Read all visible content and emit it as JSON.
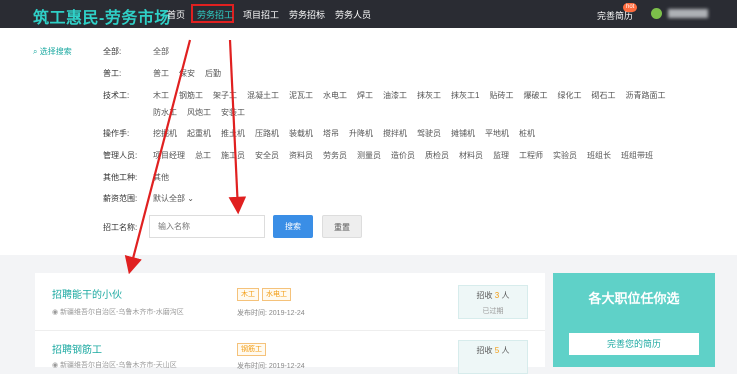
{
  "header": {
    "logo": "筑工惠民-劳务市场",
    "nav": [
      "首页",
      "劳务招工",
      "项目招工",
      "劳务招标",
      "劳务人员"
    ],
    "active_nav": "劳务招工",
    "resume": "完善简历",
    "hot": "hot"
  },
  "filter": {
    "toggle": "选择搜索",
    "rows": [
      {
        "label": "全部:",
        "options": [
          "全部"
        ]
      },
      {
        "label": "普工:",
        "options": [
          "普工",
          "保安",
          "后勤"
        ]
      },
      {
        "label": "技术工:",
        "options": [
          "木工",
          "钢筋工",
          "架子工",
          "混凝土工",
          "泥瓦工",
          "水电工",
          "焊工",
          "油漆工",
          "抹灰工",
          "抹灰工1",
          "贴砖工",
          "爆破工",
          "绿化工",
          "砌石工",
          "沥青路面工"
        ]
      },
      {
        "label": "",
        "options": [
          "防水工",
          "风炮工",
          "安装工"
        ]
      },
      {
        "label": "操作手:",
        "options": [
          "挖掘机",
          "起重机",
          "推土机",
          "压路机",
          "装载机",
          "塔吊",
          "升降机",
          "搅拌机",
          "驾驶员",
          "摊铺机",
          "平地机",
          "桩机"
        ]
      },
      {
        "label": "管理人员:",
        "options": [
          "项目经理",
          "总工",
          "施工员",
          "安全员",
          "资料员",
          "劳务员",
          "测量员",
          "造价员",
          "质检员",
          "材料员",
          "监理",
          "工程师",
          "实验员",
          "班组长",
          "班组带班"
        ]
      },
      {
        "label": "其他工种:",
        "options": [
          "其他"
        ]
      },
      {
        "label": "薪资范围:",
        "options": [
          "默认全部 ⌄"
        ]
      }
    ],
    "name_label": "招工名称:",
    "name_placeholder": "输入名称",
    "search_btn": "搜索",
    "reset_btn": "重置"
  },
  "jobs": [
    {
      "title": "招聘能干的小伙",
      "location": "新疆维吾尔自治区-乌鲁木齐市-水磨沟区",
      "tags": [
        "木工",
        "水电工"
      ],
      "pub": "发布时间: 2019-12-24",
      "recruit_pre": "招收",
      "recruit_num": "3",
      "recruit_unit": "人",
      "status": "已过期"
    },
    {
      "title": "招聘钢筋工",
      "location": "新疆维吾尔自治区-乌鲁木齐市-天山区",
      "tags": [
        "钢筋工"
      ],
      "pub": "发布时间: 2019-12-24",
      "recruit_pre": "招收",
      "recruit_num": "5",
      "recruit_unit": "人",
      "status": ""
    }
  ],
  "promo": {
    "title": "各大职位任你选",
    "button": "完善您的简历"
  },
  "colors": {
    "accent": "#2fd0c7",
    "arrow": "#e02020",
    "primary_btn": "#3a8ee6"
  }
}
